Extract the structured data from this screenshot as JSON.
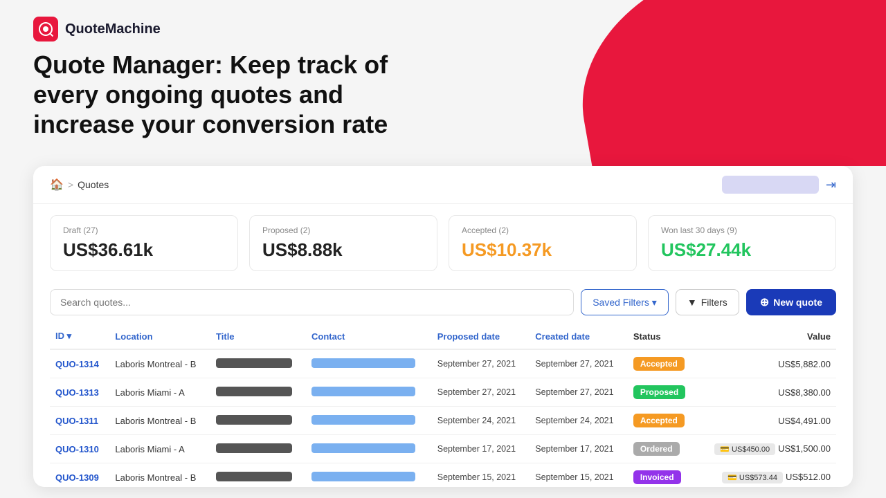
{
  "logo": {
    "name": "QuoteMachine",
    "tagline": "QuoteMachine"
  },
  "hero": {
    "title": "Quote Manager: Keep track of every ongoing quotes and increase your conversion rate"
  },
  "breadcrumb": {
    "home_icon": "🏠",
    "separator": ">",
    "current": "Quotes"
  },
  "stats": [
    {
      "label": "Draft  (27)",
      "value": "US$36.61k",
      "color": "default"
    },
    {
      "label": "Proposed  (2)",
      "value": "US$8.88k",
      "color": "default"
    },
    {
      "label": "Accepted  (2)",
      "value": "US$10.37k",
      "color": "orange"
    },
    {
      "label": "Won last 30 days  (9)",
      "value": "US$27.44k",
      "color": "green"
    }
  ],
  "toolbar": {
    "search_placeholder": "Search quotes...",
    "saved_filters_label": "Saved Filters ▾",
    "filters_label": "Filters",
    "new_quote_label": "New quote"
  },
  "table": {
    "columns": [
      {
        "key": "id",
        "label": "ID ▾",
        "color": "blue"
      },
      {
        "key": "location",
        "label": "Location",
        "color": "blue"
      },
      {
        "key": "title",
        "label": "Title",
        "color": "blue"
      },
      {
        "key": "contact",
        "label": "Contact",
        "color": "blue"
      },
      {
        "key": "proposed_date",
        "label": "Proposed date",
        "color": "blue"
      },
      {
        "key": "created_date",
        "label": "Created date",
        "color": "blue"
      },
      {
        "key": "status",
        "label": "Status",
        "color": "dark"
      },
      {
        "key": "value",
        "label": "Value",
        "color": "dark",
        "align": "right"
      }
    ],
    "rows": [
      {
        "id": "QUO-1314",
        "location": "Laboris Montreal - B",
        "proposed_date": "September 27, 2021",
        "created_date": "September 27, 2021",
        "status": "Accepted",
        "status_type": "accepted",
        "value": "US$5,882.00",
        "sub_badge": null
      },
      {
        "id": "QUO-1313",
        "location": "Laboris Miami - A",
        "proposed_date": "September 27, 2021",
        "created_date": "September 27, 2021",
        "status": "Proposed",
        "status_type": "proposed",
        "value": "US$8,380.00",
        "sub_badge": null
      },
      {
        "id": "QUO-1311",
        "location": "Laboris Montreal - B",
        "proposed_date": "September 24, 2021",
        "created_date": "September 24, 2021",
        "status": "Accepted",
        "status_type": "accepted",
        "value": "US$4,491.00",
        "sub_badge": null
      },
      {
        "id": "QUO-1310",
        "location": "Laboris Miami - A",
        "proposed_date": "September 17, 2021",
        "created_date": "September 17, 2021",
        "status": "Ordered",
        "status_type": "ordered",
        "value": "US$1,500.00",
        "sub_badge": "US$450.00"
      },
      {
        "id": "QUO-1309",
        "location": "Laboris Montreal - B",
        "proposed_date": "September 15, 2021",
        "created_date": "September 15, 2021",
        "status": "Invoiced",
        "status_type": "invoiced",
        "value": "US$512.00",
        "sub_badge": "US$573.44"
      }
    ]
  }
}
